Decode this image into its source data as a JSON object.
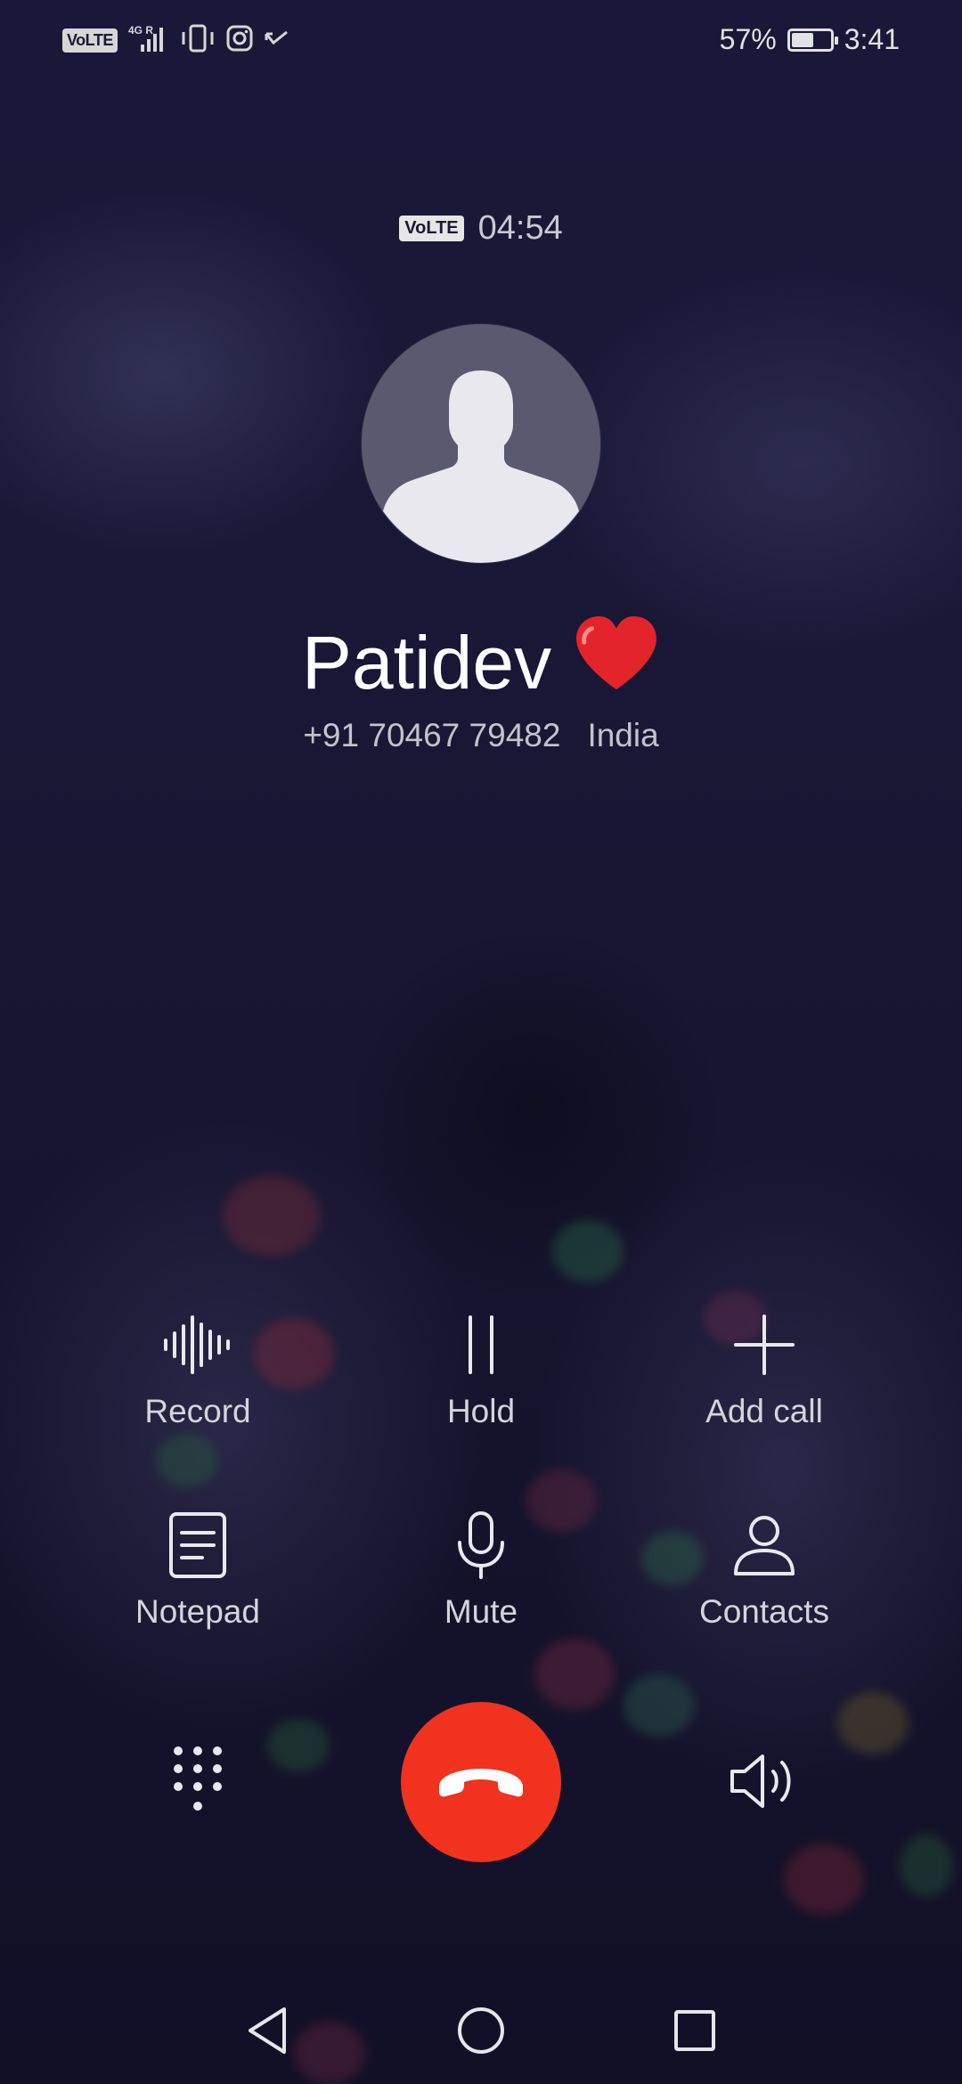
{
  "status_bar": {
    "volte": "VoLTE",
    "network": "4G R",
    "battery_percent": "57%",
    "battery_level": 0.57,
    "time": "3:41",
    "icons": [
      "volte-icon",
      "signal-icon",
      "vibrate-icon",
      "instagram-icon",
      "missed-call-icon",
      "battery-icon"
    ]
  },
  "call": {
    "volte": "VoLTE",
    "duration": "04:54",
    "contact_name": "Patidev",
    "name_emoji": "❤️",
    "phone_number": "+91 70467 79482",
    "location": "India"
  },
  "actions": [
    {
      "id": "record",
      "label": "Record",
      "icon": "waveform-icon"
    },
    {
      "id": "hold",
      "label": "Hold",
      "icon": "pause-icon"
    },
    {
      "id": "add-call",
      "label": "Add call",
      "icon": "plus-icon"
    },
    {
      "id": "notepad",
      "label": "Notepad",
      "icon": "notepad-icon"
    },
    {
      "id": "mute",
      "label": "Mute",
      "icon": "microphone-icon"
    },
    {
      "id": "contacts",
      "label": "Contacts",
      "icon": "person-icon"
    }
  ],
  "bottom_controls": {
    "dialpad_icon": "dialpad-icon",
    "end_call_icon": "hang-up-icon",
    "end_call_color": "#f0321f",
    "speaker_icon": "speaker-icon"
  },
  "nav_bar": {
    "back_icon": "back-triangle-icon",
    "home_icon": "home-circle-icon",
    "recents_icon": "recents-square-icon"
  }
}
